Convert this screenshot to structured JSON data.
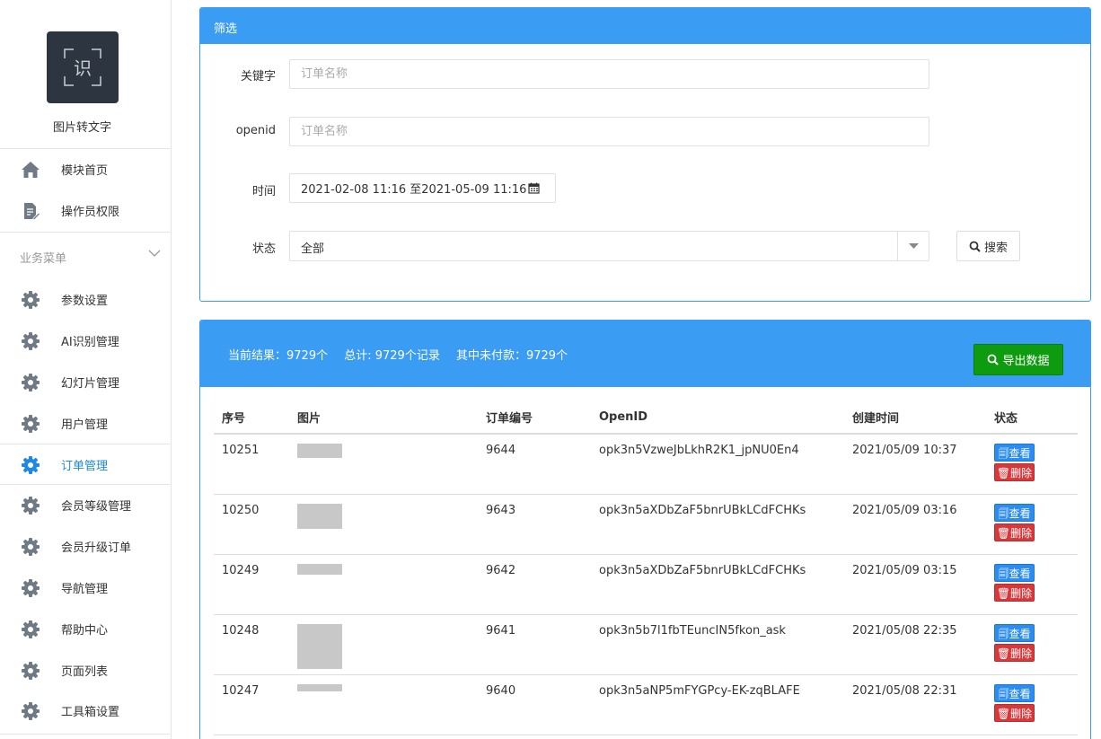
{
  "sidebar": {
    "logo_glyph": "识",
    "app_name": "图片转文字",
    "top_items": [
      {
        "label": "模块首页",
        "icon": "home-icon"
      },
      {
        "label": "操作员权限",
        "icon": "file-edit-icon"
      }
    ],
    "group_title": "业务菜单",
    "items": [
      {
        "label": "参数设置",
        "icon": "gear-icon"
      },
      {
        "label": "AI识别管理",
        "icon": "gear-icon"
      },
      {
        "label": "幻灯片管理",
        "icon": "gear-icon"
      },
      {
        "label": "用户管理",
        "icon": "gear-icon"
      },
      {
        "label": "订单管理",
        "icon": "gear-icon",
        "active": true
      },
      {
        "label": "会员等级管理",
        "icon": "gear-icon"
      },
      {
        "label": "会员升级订单",
        "icon": "gear-icon"
      },
      {
        "label": "导航管理",
        "icon": "gear-icon"
      },
      {
        "label": "帮助中心",
        "icon": "gear-icon"
      },
      {
        "label": "页面列表",
        "icon": "gear-icon"
      },
      {
        "label": "工具箱设置",
        "icon": "gear-icon"
      }
    ],
    "active_color": "#1e88e5"
  },
  "filter": {
    "title": "筛选",
    "keyword_label": "关键字",
    "keyword_placeholder": "订单名称",
    "openid_label": "openid",
    "openid_placeholder": "订单名称",
    "time_label": "时间",
    "time_value": "2021-02-08 11:16 至2021-05-09 11:16",
    "status_label": "状态",
    "status_value": "全部",
    "search_label": "搜索"
  },
  "results": {
    "current": "当前结果：9729个",
    "total": "总计: 9729个记录",
    "unpaid": "其中未付款：9729个",
    "export_label": "导出数据",
    "columns": [
      "序号",
      "图片",
      "订单编号",
      "OpenID",
      "创建时间",
      "状态"
    ],
    "view_label": "查看",
    "delete_label": "删除",
    "rows": [
      {
        "id": "10251",
        "order_no": "9644",
        "openid": "opk3n5VzweJbLkhR2K1_jpNU0En4",
        "created": "2021/05/09 10:37"
      },
      {
        "id": "10250",
        "order_no": "9643",
        "openid": "opk3n5aXDbZaF5bnrUBkLCdFCHKs",
        "created": "2021/05/09 03:16"
      },
      {
        "id": "10249",
        "order_no": "9642",
        "openid": "opk3n5aXDbZaF5bnrUBkLCdFCHKs",
        "created": "2021/05/09 03:15"
      },
      {
        "id": "10248",
        "order_no": "9641",
        "openid": "opk3n5b7l1fbTEuncIN5fkon_ask",
        "created": "2021/05/08 22:35"
      },
      {
        "id": "10247",
        "order_no": "9640",
        "openid": "opk3n5aNP5mFYGPcy-EK-zqBLAFE",
        "created": "2021/05/08 22:31"
      }
    ]
  },
  "colors": {
    "panel_header": "#3b9cf3",
    "export_button": "#0f9b0f",
    "view_button": "#2d8cf0",
    "delete_button": "#d9383a"
  }
}
